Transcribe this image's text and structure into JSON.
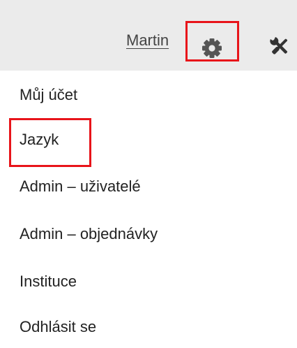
{
  "header": {
    "user_name": "Martin",
    "settings_icon": "gear-icon",
    "tools_icon": "tools-icon",
    "background_color": "#ebebeb"
  },
  "menu": {
    "items": [
      {
        "label": "Můj účet"
      },
      {
        "label": "Jazyk"
      },
      {
        "label": "Admin – uživatelé"
      },
      {
        "label": "Admin – objednávky"
      },
      {
        "label": "Instituce"
      },
      {
        "label": "Odhlásit se"
      }
    ]
  },
  "highlights": {
    "color": "#e8141a",
    "targets": [
      "settings-button",
      "menu-item-jazyk"
    ]
  }
}
